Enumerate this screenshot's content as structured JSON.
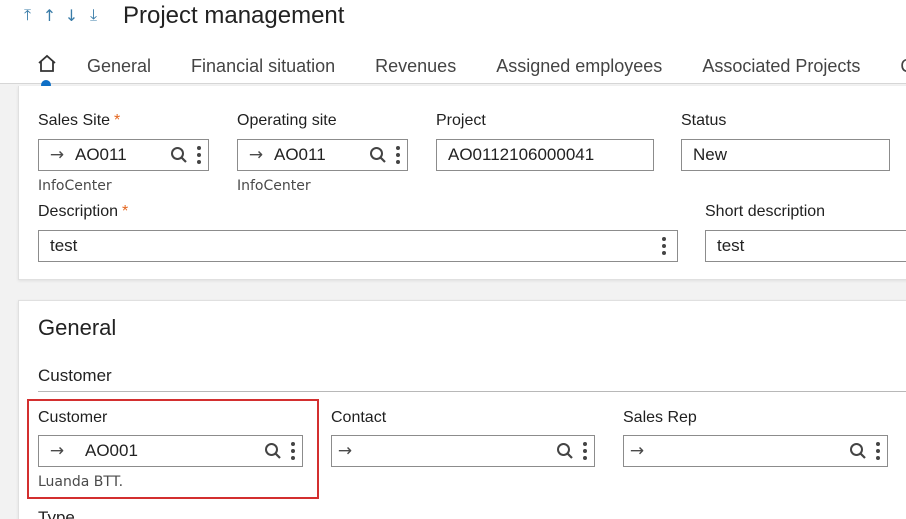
{
  "header": {
    "title": "Project management",
    "nav_arrows": [
      "first-record-icon",
      "previous-record-icon",
      "next-record-icon",
      "last-record-icon"
    ]
  },
  "tabs": [
    {
      "label": "General"
    },
    {
      "label": "Financial situation"
    },
    {
      "label": "Revenues"
    },
    {
      "label": "Assigned employees"
    },
    {
      "label": "Associated Projects"
    },
    {
      "label": "C"
    }
  ],
  "header_fields": {
    "sales_site": {
      "label": "Sales Site",
      "required_mark": "*",
      "value": "AO011",
      "sub": "InfoCenter"
    },
    "operating_site": {
      "label": "Operating site",
      "value": "AO011",
      "sub": "InfoCenter"
    },
    "project": {
      "label": "Project",
      "value": "AO0112106000041"
    },
    "status": {
      "label": "Status",
      "value": "New"
    },
    "description": {
      "label": "Description",
      "required_mark": "*",
      "value": "test"
    },
    "short_description": {
      "label": "Short description",
      "value": "test"
    }
  },
  "general": {
    "title": "General",
    "customer_section": "Customer",
    "customer": {
      "label": "Customer",
      "value": "AO001",
      "sub": "Luanda BTT."
    },
    "contact": {
      "label": "Contact",
      "value": ""
    },
    "sales_rep": {
      "label": "Sales Rep",
      "value": ""
    },
    "next_label": "Type"
  },
  "colors": {
    "accent": "#0f6fc6",
    "required": "#e4661e",
    "highlight": "#d32f2f"
  }
}
